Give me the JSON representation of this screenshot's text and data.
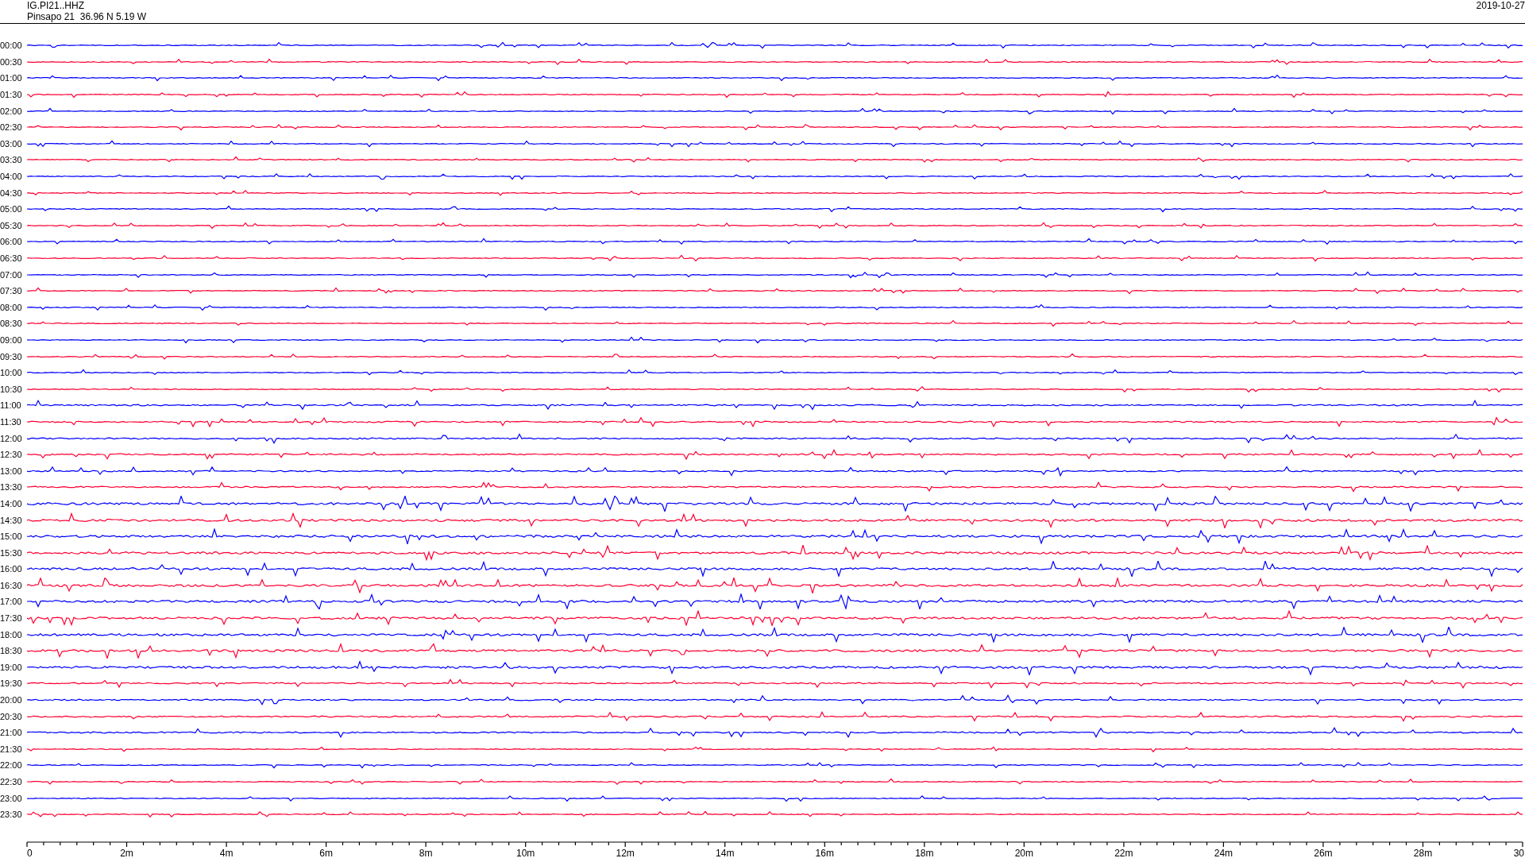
{
  "header": {
    "channel": "IG.PI21..HHZ",
    "station": "Pinsapo 21  36.96 N 5.19 W",
    "date": "2019-10-27"
  },
  "rows": [
    {
      "time": "00:00",
      "color": "#0000ff"
    },
    {
      "time": "00:30",
      "color": "#ff0033"
    },
    {
      "time": "01:00",
      "color": "#0000ff"
    },
    {
      "time": "01:30",
      "color": "#ff0033"
    },
    {
      "time": "02:00",
      "color": "#0000ff"
    },
    {
      "time": "02:30",
      "color": "#ff0033"
    },
    {
      "time": "03:00",
      "color": "#0000ff"
    },
    {
      "time": "03:30",
      "color": "#ff0033"
    },
    {
      "time": "04:00",
      "color": "#0000ff"
    },
    {
      "time": "04:30",
      "color": "#ff0033"
    },
    {
      "time": "05:00",
      "color": "#0000ff"
    },
    {
      "time": "05:30",
      "color": "#ff0033"
    },
    {
      "time": "06:00",
      "color": "#0000ff"
    },
    {
      "time": "06:30",
      "color": "#ff0033"
    },
    {
      "time": "07:00",
      "color": "#0000ff"
    },
    {
      "time": "07:30",
      "color": "#ff0033"
    },
    {
      "time": "08:00",
      "color": "#0000ff"
    },
    {
      "time": "08:30",
      "color": "#ff0033"
    },
    {
      "time": "09:00",
      "color": "#0000ff"
    },
    {
      "time": "09:30",
      "color": "#ff0033"
    },
    {
      "time": "10:00",
      "color": "#0000ff"
    },
    {
      "time": "10:30",
      "color": "#ff0033"
    },
    {
      "time": "11:00",
      "color": "#0000ff"
    },
    {
      "time": "11:30",
      "color": "#ff0033"
    },
    {
      "time": "12:00",
      "color": "#0000ff"
    },
    {
      "time": "12:30",
      "color": "#ff0033"
    },
    {
      "time": "13:00",
      "color": "#0000ff"
    },
    {
      "time": "13:30",
      "color": "#ff0033"
    },
    {
      "time": "14:00",
      "color": "#0000ff"
    },
    {
      "time": "14:30",
      "color": "#ff0033"
    },
    {
      "time": "15:00",
      "color": "#0000ff"
    },
    {
      "time": "15:30",
      "color": "#ff0033"
    },
    {
      "time": "16:00",
      "color": "#0000ff"
    },
    {
      "time": "16:30",
      "color": "#ff0033"
    },
    {
      "time": "17:00",
      "color": "#0000ff"
    },
    {
      "time": "17:30",
      "color": "#ff0033"
    },
    {
      "time": "18:00",
      "color": "#0000ff"
    },
    {
      "time": "18:30",
      "color": "#ff0033"
    },
    {
      "time": "19:00",
      "color": "#0000ff"
    },
    {
      "time": "19:30",
      "color": "#ff0033"
    },
    {
      "time": "20:00",
      "color": "#0000ff"
    },
    {
      "time": "20:30",
      "color": "#ff0033"
    },
    {
      "time": "21:00",
      "color": "#0000ff"
    },
    {
      "time": "21:30",
      "color": "#ff0033"
    },
    {
      "time": "22:00",
      "color": "#0000ff"
    },
    {
      "time": "22:30",
      "color": "#ff0033"
    },
    {
      "time": "23:00",
      "color": "#0000ff"
    },
    {
      "time": "23:30",
      "color": "#ff0033"
    }
  ],
  "x_axis": {
    "ticks": [
      "0",
      "2m",
      "4m",
      "6m",
      "8m",
      "10m",
      "12m",
      "14m",
      "16m",
      "18m",
      "20m",
      "22m",
      "24m",
      "26m",
      "28m",
      "30"
    ]
  }
}
